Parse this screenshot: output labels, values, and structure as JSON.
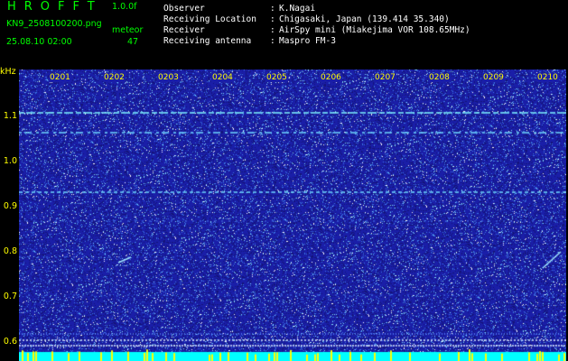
{
  "logo": "HROFFT",
  "version": "1.0.0f",
  "filename": "KN9_2508100200.png",
  "timestamp": "25.08.10 02:00",
  "meteor_label": "meteor",
  "meteor_count": "47",
  "info": [
    {
      "label": "Observer",
      "value": "K.Nagai"
    },
    {
      "label": "Receiving Location",
      "value": "Chigasaki, Japan (139.414 35.340)"
    },
    {
      "label": "Receiver",
      "value": "AirSpy mini (Miakejima VOR 108.65MHz)"
    },
    {
      "label": "Receiving antenna",
      "value": "Maspro FM-3"
    }
  ],
  "axis": {
    "unit": "kHz",
    "y_ticks": [
      "1.1",
      "1.0",
      "0.9",
      "0.8",
      "0.7",
      "0.6"
    ],
    "x_ticks": [
      "0201",
      "0202",
      "0203",
      "0204",
      "0205",
      "0206",
      "0207",
      "0208",
      "0209",
      "0210"
    ]
  },
  "colors": {
    "background": "#1a1ea8",
    "tick_labels": "#ffff00",
    "header_text": "#ffffff",
    "logo": "#00ff00",
    "bottom_band": "#00ffff"
  }
}
